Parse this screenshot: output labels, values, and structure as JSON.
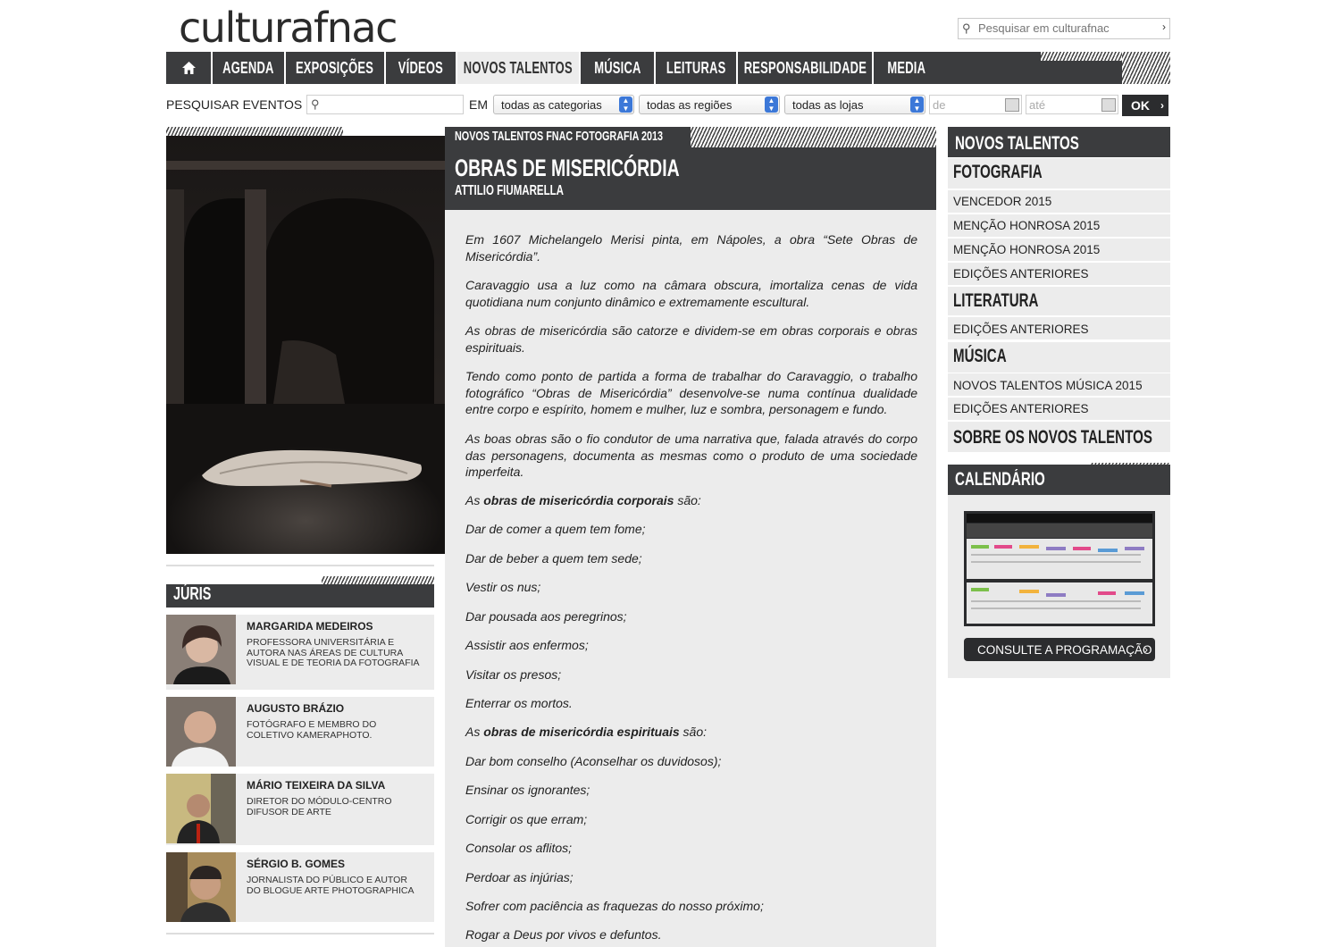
{
  "header": {
    "logo_part1": "cultura",
    "logo_part2": "fnac",
    "search_placeholder": "Pesquisar em culturafnac"
  },
  "nav": {
    "items": [
      "AGENDA",
      "EXPOSIÇÕES",
      "VÍDEOS",
      "NOVOS TALENTOS",
      "MÚSICA",
      "LEITURAS",
      "RESPONSABILIDADE",
      "MEDIA"
    ],
    "active": "NOVOS TALENTOS"
  },
  "event_search": {
    "label": "PESQUISAR EVENTOS",
    "in_label": "EM",
    "category": "todas as categorias",
    "region": "todas as regiões",
    "store": "todas as lojas",
    "from_placeholder": "de",
    "to_placeholder": "até",
    "ok_label": "OK"
  },
  "article": {
    "kicker": "NOVOS TALENTOS FNAC FOTOGRAFIA 2013",
    "title": "OBRAS DE MISERICÓRDIA",
    "author": "ATTILIO FIUMARELLA",
    "p1": "Em 1607 Michelangelo Merisi pinta, em Nápoles, a obra “Sete Obras de Misericórdia”.",
    "p2": "Caravaggio usa a luz como na câmara obscura, imortaliza cenas de vida quotidiana num conjunto dinâmico e extremamente escultural.",
    "p3": "As obras de misericórdia são catorze e dividem-se em obras corporais e obras espirituais.",
    "p4": "Tendo como ponto de partida a forma de trabalhar do Caravaggio, o trabalho fotográfico “Obras de Misericórdia” desenvolve-se numa contínua dualidade entre corpo e espírito, homem e mulher, luz e sombra, personagem e fundo.",
    "p5": "As boas obras são o fio condutor de uma narrativa que, falada através do corpo das personagens, documenta as mesmas como o produto de uma sociedade imperfeita.",
    "corporais_pre": "As ",
    "corporais_bold": "obras de misericórdia corporais",
    "corporais_post": " são:",
    "corporais": [
      "Dar de comer a quem tem fome;",
      "Dar de beber a quem tem sede;",
      "Vestir os nus;",
      "Dar pousada aos peregrinos;",
      "Assistir aos enfermos;",
      "Visitar os presos;",
      "Enterrar os mortos."
    ],
    "espirituais_pre": "As ",
    "espirituais_bold": "obras de misericórdia espirituais",
    "espirituais_post": " são:",
    "espirituais": [
      "Dar bom conselho (Aconselhar os duvidosos);",
      "Ensinar os ignorantes;",
      "Corrigir os que erram;",
      "Consolar os aflitos;",
      "Perdoar as injúrias;",
      "Sofrer com paciência as fraquezas do nosso próximo;",
      "Rogar a Deus por vivos e defuntos."
    ]
  },
  "juris": {
    "title": "JÚRIS",
    "members": [
      {
        "name": "MARGARIDA MEDEIROS",
        "desc": "PROFESSORA UNIVERSITÁRIA E AUTORA NAS ÁREAS DE CULTURA VISUAL E DE TEORIA DA FOTOGRAFIA"
      },
      {
        "name": "AUGUSTO BRÁZIO",
        "desc": "FOTÓGRAFO E MEMBRO DO COLETIVO KAMERAPHOTO."
      },
      {
        "name": "MÁRIO TEIXEIRA DA SILVA",
        "desc": "DIRETOR DO MÓDULO-CENTRO DIFUSOR DE ARTE"
      },
      {
        "name": "SÉRGIO B. GOMES",
        "desc": "JORNALISTA DO PÚBLICO E AUTOR DO BLOGUE ARTE PHOTOGRAPHICA"
      }
    ]
  },
  "sidebar": {
    "title": "NOVOS TALENTOS",
    "fotografia": "FOTOGRAFIA",
    "fotografia_items": [
      "VENCEDOR 2015",
      "MENÇÃO HONROSA 2015",
      "MENÇÃO HONROSA 2015",
      "EDIÇÕES ANTERIORES"
    ],
    "literatura": "LITERATURA",
    "literatura_items": [
      "EDIÇÕES ANTERIORES"
    ],
    "musica": "MÚSICA",
    "musica_items": [
      "NOVOS TALENTOS MÚSICA 2015",
      "EDIÇÕES ANTERIORES"
    ],
    "sobre": "SOBRE OS NOVOS TALENTOS",
    "calendar_title": "CALENDÁRIO",
    "calendar_button": "CONSULTE A PROGRAMAÇÃO"
  }
}
